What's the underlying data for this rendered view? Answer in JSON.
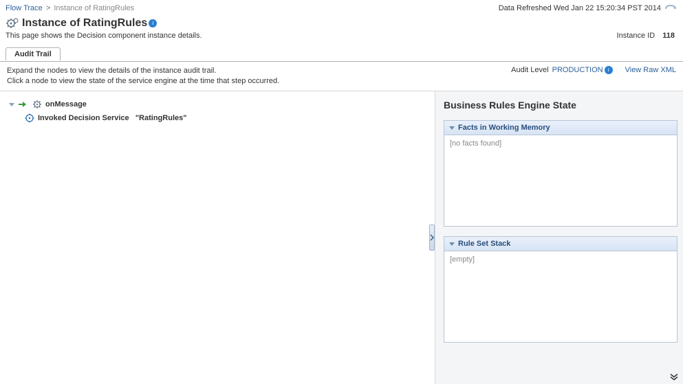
{
  "breadcrumb": {
    "link": "Flow Trace",
    "separator": ">",
    "current": "Instance of RatingRules"
  },
  "refresh": {
    "label": "Data Refreshed Wed Jan 22 15:20:34 PST 2014"
  },
  "title": "Instance of RatingRules",
  "subtitle": "This page shows the Decision component instance details.",
  "instance": {
    "label": "Instance ID",
    "value": "118"
  },
  "tab": "Audit Trail",
  "instructions": {
    "line1": "Expand the nodes to view the details of the instance audit trail.",
    "line2": "Click a node to view the state of the service engine at the time that step occurred."
  },
  "auditLevel": {
    "label": "Audit Level",
    "value": "PRODUCTION"
  },
  "viewRawXml": "View Raw XML",
  "tree": {
    "root": "onMessage",
    "child_prefix": "Invoked Decision Service",
    "child_name": "\"RatingRules\""
  },
  "rightPanel": {
    "title": "Business Rules Engine State",
    "facts": {
      "header": "Facts in Working Memory",
      "body": "[no facts found]"
    },
    "ruleset": {
      "header": "Rule Set Stack",
      "body": "[empty]"
    }
  }
}
